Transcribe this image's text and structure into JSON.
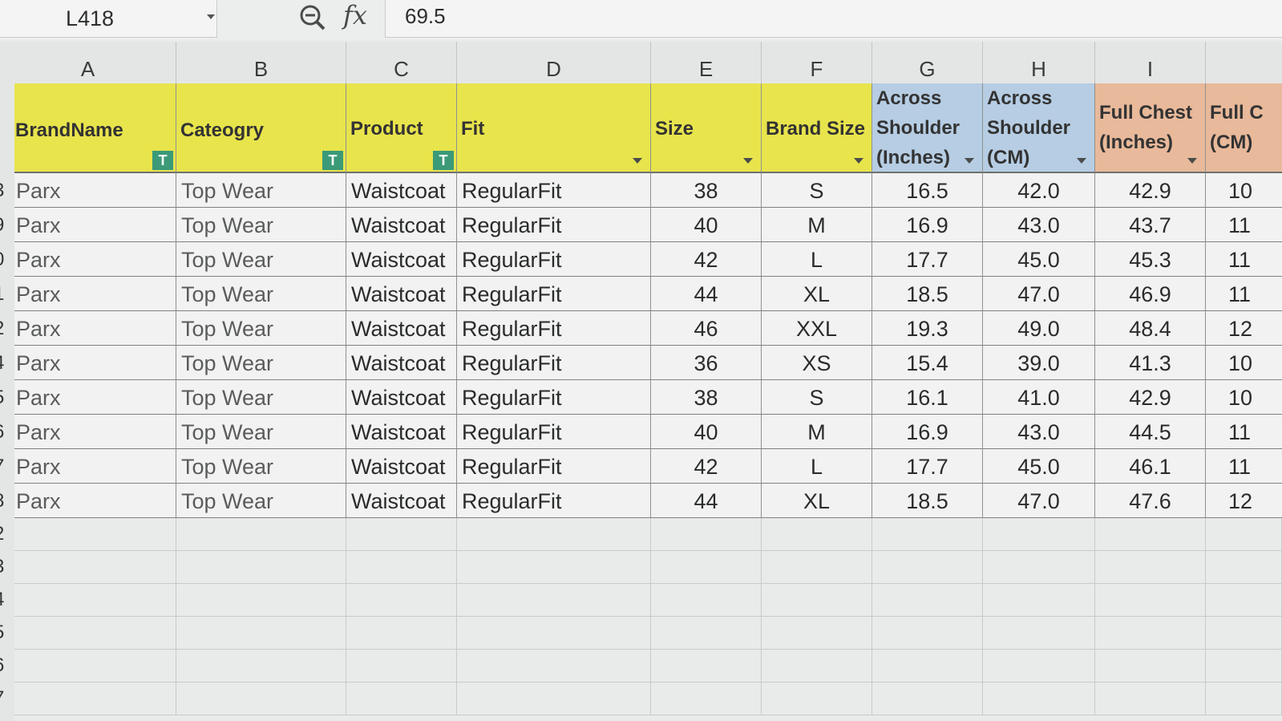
{
  "formula_bar": {
    "cell_ref": "L418",
    "zoom_icon": "zoom-out-icon",
    "fx_label": "fx",
    "value": "69.5"
  },
  "columns": [
    "A",
    "B",
    "C",
    "D",
    "E",
    "F",
    "G",
    "H",
    "I",
    ""
  ],
  "headers": {
    "brand": "BrandName",
    "category": "Cateogry",
    "product": "Product",
    "fit": "Fit",
    "size": "Size",
    "brand_size": "Brand Size",
    "across_in_1": "Across",
    "across_in_2": "Shoulder",
    "across_in_3": "(Inches)",
    "across_cm_1": "Across",
    "across_cm_2": "Shoulder",
    "across_cm_3": "(CM)",
    "chest_in_1": "Full Chest",
    "chest_in_2": "(Inches)",
    "chest_cm_1": "Full C",
    "chest_cm_2": "(CM)"
  },
  "header_colors": {
    "yellow": "#e8e44c",
    "blue": "#b6cde3",
    "orange": "#e8b99a",
    "filter_active": "#3b9a78"
  },
  "rows": [
    {
      "num": "3",
      "brand": "Parx",
      "category": "Top Wear",
      "product": "Waistcoat",
      "fit": "RegularFit",
      "size": "38",
      "brand_size": "S",
      "shoulder_in": "16.5",
      "shoulder_cm": "42.0",
      "chest_in": "42.9",
      "chest_cm": "10"
    },
    {
      "num": "9",
      "brand": "Parx",
      "category": "Top Wear",
      "product": "Waistcoat",
      "fit": "RegularFit",
      "size": "40",
      "brand_size": "M",
      "shoulder_in": "16.9",
      "shoulder_cm": "43.0",
      "chest_in": "43.7",
      "chest_cm": "11"
    },
    {
      "num": "0",
      "brand": "Parx",
      "category": "Top Wear",
      "product": "Waistcoat",
      "fit": "RegularFit",
      "size": "42",
      "brand_size": "L",
      "shoulder_in": "17.7",
      "shoulder_cm": "45.0",
      "chest_in": "45.3",
      "chest_cm": "11"
    },
    {
      "num": "1",
      "brand": "Parx",
      "category": "Top Wear",
      "product": "Waistcoat",
      "fit": "RegularFit",
      "size": "44",
      "brand_size": "XL",
      "shoulder_in": "18.5",
      "shoulder_cm": "47.0",
      "chest_in": "46.9",
      "chest_cm": "11"
    },
    {
      "num": "2",
      "brand": "Parx",
      "category": "Top Wear",
      "product": "Waistcoat",
      "fit": "RegularFit",
      "size": "46",
      "brand_size": "XXL",
      "shoulder_in": "19.3",
      "shoulder_cm": "49.0",
      "chest_in": "48.4",
      "chest_cm": "12"
    },
    {
      "num": "4",
      "brand": "Parx",
      "category": "Top Wear",
      "product": "Waistcoat",
      "fit": "RegularFit",
      "size": "36",
      "brand_size": "XS",
      "shoulder_in": "15.4",
      "shoulder_cm": "39.0",
      "chest_in": "41.3",
      "chest_cm": "10"
    },
    {
      "num": "5",
      "brand": "Parx",
      "category": "Top Wear",
      "product": "Waistcoat",
      "fit": "RegularFit",
      "size": "38",
      "brand_size": "S",
      "shoulder_in": "16.1",
      "shoulder_cm": "41.0",
      "chest_in": "42.9",
      "chest_cm": "10"
    },
    {
      "num": "6",
      "brand": "Parx",
      "category": "Top Wear",
      "product": "Waistcoat",
      "fit": "RegularFit",
      "size": "40",
      "brand_size": "M",
      "shoulder_in": "16.9",
      "shoulder_cm": "43.0",
      "chest_in": "44.5",
      "chest_cm": "11"
    },
    {
      "num": "7",
      "brand": "Parx",
      "category": "Top Wear",
      "product": "Waistcoat",
      "fit": "RegularFit",
      "size": "42",
      "brand_size": "L",
      "shoulder_in": "17.7",
      "shoulder_cm": "45.0",
      "chest_in": "46.1",
      "chest_cm": "11"
    },
    {
      "num": "8",
      "brand": "Parx",
      "category": "Top Wear",
      "product": "Waistcoat",
      "fit": "RegularFit",
      "size": "44",
      "brand_size": "XL",
      "shoulder_in": "18.5",
      "shoulder_cm": "47.0",
      "chest_in": "47.6",
      "chest_cm": "12"
    }
  ],
  "empty_row_nums": [
    "2",
    "3",
    "4",
    "5",
    "6",
    "7"
  ]
}
